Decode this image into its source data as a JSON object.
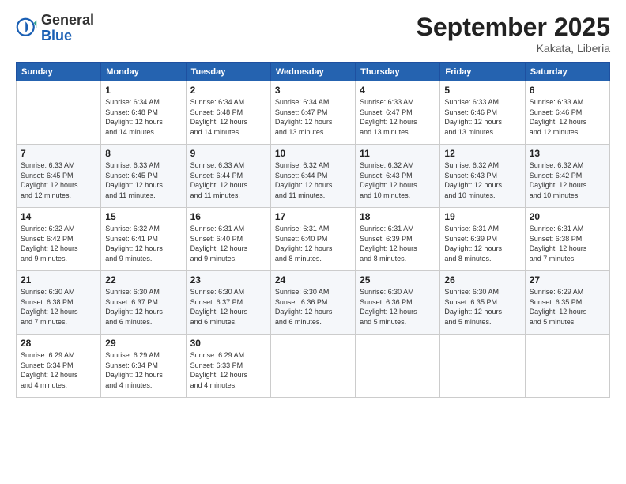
{
  "header": {
    "logo_general": "General",
    "logo_blue": "Blue",
    "month_title": "September 2025",
    "location": "Kakata, Liberia"
  },
  "days_of_week": [
    "Sunday",
    "Monday",
    "Tuesday",
    "Wednesday",
    "Thursday",
    "Friday",
    "Saturday"
  ],
  "weeks": [
    [
      {
        "day": "",
        "info": ""
      },
      {
        "day": "1",
        "info": "Sunrise: 6:34 AM\nSunset: 6:48 PM\nDaylight: 12 hours\nand 14 minutes."
      },
      {
        "day": "2",
        "info": "Sunrise: 6:34 AM\nSunset: 6:48 PM\nDaylight: 12 hours\nand 14 minutes."
      },
      {
        "day": "3",
        "info": "Sunrise: 6:34 AM\nSunset: 6:47 PM\nDaylight: 12 hours\nand 13 minutes."
      },
      {
        "day": "4",
        "info": "Sunrise: 6:33 AM\nSunset: 6:47 PM\nDaylight: 12 hours\nand 13 minutes."
      },
      {
        "day": "5",
        "info": "Sunrise: 6:33 AM\nSunset: 6:46 PM\nDaylight: 12 hours\nand 13 minutes."
      },
      {
        "day": "6",
        "info": "Sunrise: 6:33 AM\nSunset: 6:46 PM\nDaylight: 12 hours\nand 12 minutes."
      }
    ],
    [
      {
        "day": "7",
        "info": "Sunrise: 6:33 AM\nSunset: 6:45 PM\nDaylight: 12 hours\nand 12 minutes."
      },
      {
        "day": "8",
        "info": "Sunrise: 6:33 AM\nSunset: 6:45 PM\nDaylight: 12 hours\nand 11 minutes."
      },
      {
        "day": "9",
        "info": "Sunrise: 6:33 AM\nSunset: 6:44 PM\nDaylight: 12 hours\nand 11 minutes."
      },
      {
        "day": "10",
        "info": "Sunrise: 6:32 AM\nSunset: 6:44 PM\nDaylight: 12 hours\nand 11 minutes."
      },
      {
        "day": "11",
        "info": "Sunrise: 6:32 AM\nSunset: 6:43 PM\nDaylight: 12 hours\nand 10 minutes."
      },
      {
        "day": "12",
        "info": "Sunrise: 6:32 AM\nSunset: 6:43 PM\nDaylight: 12 hours\nand 10 minutes."
      },
      {
        "day": "13",
        "info": "Sunrise: 6:32 AM\nSunset: 6:42 PM\nDaylight: 12 hours\nand 10 minutes."
      }
    ],
    [
      {
        "day": "14",
        "info": "Sunrise: 6:32 AM\nSunset: 6:42 PM\nDaylight: 12 hours\nand 9 minutes."
      },
      {
        "day": "15",
        "info": "Sunrise: 6:32 AM\nSunset: 6:41 PM\nDaylight: 12 hours\nand 9 minutes."
      },
      {
        "day": "16",
        "info": "Sunrise: 6:31 AM\nSunset: 6:40 PM\nDaylight: 12 hours\nand 9 minutes."
      },
      {
        "day": "17",
        "info": "Sunrise: 6:31 AM\nSunset: 6:40 PM\nDaylight: 12 hours\nand 8 minutes."
      },
      {
        "day": "18",
        "info": "Sunrise: 6:31 AM\nSunset: 6:39 PM\nDaylight: 12 hours\nand 8 minutes."
      },
      {
        "day": "19",
        "info": "Sunrise: 6:31 AM\nSunset: 6:39 PM\nDaylight: 12 hours\nand 8 minutes."
      },
      {
        "day": "20",
        "info": "Sunrise: 6:31 AM\nSunset: 6:38 PM\nDaylight: 12 hours\nand 7 minutes."
      }
    ],
    [
      {
        "day": "21",
        "info": "Sunrise: 6:30 AM\nSunset: 6:38 PM\nDaylight: 12 hours\nand 7 minutes."
      },
      {
        "day": "22",
        "info": "Sunrise: 6:30 AM\nSunset: 6:37 PM\nDaylight: 12 hours\nand 6 minutes."
      },
      {
        "day": "23",
        "info": "Sunrise: 6:30 AM\nSunset: 6:37 PM\nDaylight: 12 hours\nand 6 minutes."
      },
      {
        "day": "24",
        "info": "Sunrise: 6:30 AM\nSunset: 6:36 PM\nDaylight: 12 hours\nand 6 minutes."
      },
      {
        "day": "25",
        "info": "Sunrise: 6:30 AM\nSunset: 6:36 PM\nDaylight: 12 hours\nand 5 minutes."
      },
      {
        "day": "26",
        "info": "Sunrise: 6:30 AM\nSunset: 6:35 PM\nDaylight: 12 hours\nand 5 minutes."
      },
      {
        "day": "27",
        "info": "Sunrise: 6:29 AM\nSunset: 6:35 PM\nDaylight: 12 hours\nand 5 minutes."
      }
    ],
    [
      {
        "day": "28",
        "info": "Sunrise: 6:29 AM\nSunset: 6:34 PM\nDaylight: 12 hours\nand 4 minutes."
      },
      {
        "day": "29",
        "info": "Sunrise: 6:29 AM\nSunset: 6:34 PM\nDaylight: 12 hours\nand 4 minutes."
      },
      {
        "day": "30",
        "info": "Sunrise: 6:29 AM\nSunset: 6:33 PM\nDaylight: 12 hours\nand 4 minutes."
      },
      {
        "day": "",
        "info": ""
      },
      {
        "day": "",
        "info": ""
      },
      {
        "day": "",
        "info": ""
      },
      {
        "day": "",
        "info": ""
      }
    ]
  ]
}
